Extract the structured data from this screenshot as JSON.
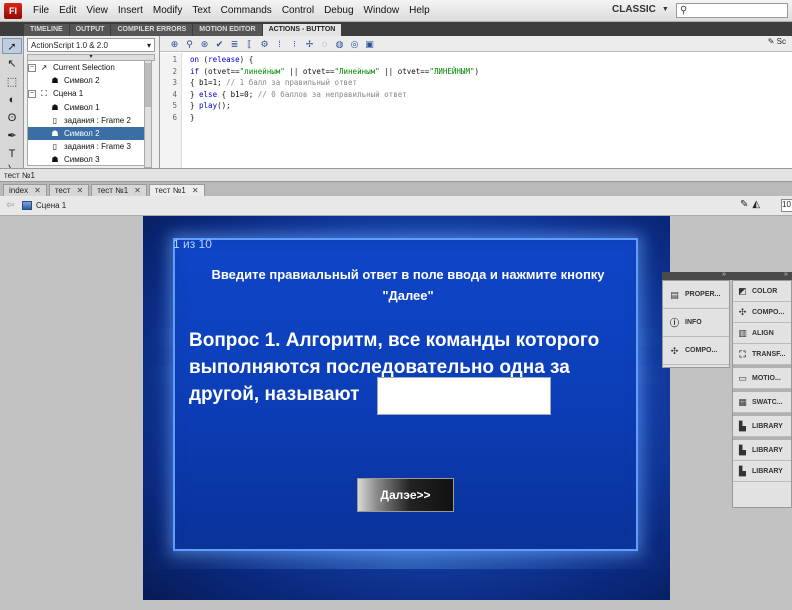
{
  "menubar": {
    "logo": "Fl",
    "items": [
      "File",
      "Edit",
      "View",
      "Insert",
      "Modify",
      "Text",
      "Commands",
      "Control",
      "Debug",
      "Window",
      "Help"
    ],
    "workspace": "CLASSIC",
    "search_icon": "search-icon"
  },
  "panel_tabs": [
    "TIMELINE",
    "OUTPUT",
    "COMPILER ERRORS",
    "MOTION EDITOR",
    "ACTIONS - BUTTON"
  ],
  "actions": {
    "version": "ActionScript 1.0 & 2.0",
    "tree": [
      {
        "label": "Current Selection",
        "expander": "−",
        "icon": "selection-icon"
      },
      {
        "label": "Символ 2",
        "icon": "button-symbol-icon"
      },
      {
        "label": "Сцена 1",
        "expander": "−",
        "icon": "scene-icon"
      },
      {
        "label": "Символ 1",
        "icon": "button-symbol-icon"
      },
      {
        "label": "задания : Frame 2",
        "icon": "frame-icon"
      },
      {
        "label": "Символ 2",
        "icon": "button-symbol-icon",
        "selected": true
      },
      {
        "label": "задания : Frame 3",
        "icon": "frame-icon"
      },
      {
        "label": "Символ 3",
        "icon": "button-symbol-icon"
      }
    ],
    "script_assist": "Sc",
    "code_lines": [
      [
        {
          "t": "kw",
          "v": "on"
        },
        {
          "t": "txt",
          "v": " ("
        },
        {
          "t": "kw",
          "v": "release"
        },
        {
          "t": "txt",
          "v": ") {"
        }
      ],
      [
        {
          "t": "kw",
          "v": "if"
        },
        {
          "t": "txt",
          "v": " (otvet=="
        },
        {
          "t": "str",
          "v": "\"линейным\""
        },
        {
          "t": "txt",
          "v": " || otvet=="
        },
        {
          "t": "str",
          "v": "\"Линейным\""
        },
        {
          "t": "txt",
          "v": " || otvet=="
        },
        {
          "t": "str",
          "v": "\"ЛИНЕЙНЫМ\""
        },
        {
          "t": "txt",
          "v": ")"
        }
      ],
      [
        {
          "t": "txt",
          "v": "{ b1=1; "
        },
        {
          "t": "cmt",
          "v": "// 1 балл за правильный ответ"
        }
      ],
      [
        {
          "t": "txt",
          "v": "} "
        },
        {
          "t": "kw",
          "v": "else"
        },
        {
          "t": "txt",
          "v": " { b1=0; "
        },
        {
          "t": "cmt",
          "v": "// 0 баллов за неправильный ответ"
        }
      ],
      [
        {
          "t": "txt",
          "v": "} "
        },
        {
          "t": "kw",
          "v": "play"
        },
        {
          "t": "txt",
          "v": "();"
        }
      ],
      [
        {
          "t": "txt",
          "v": "}"
        }
      ]
    ],
    "line_numbers": [
      "1",
      "2",
      "3",
      "4",
      "5",
      "6"
    ],
    "status": "тест №1"
  },
  "doc_tabs": [
    {
      "label": "index"
    },
    {
      "label": "тест"
    },
    {
      "label": "тест №1"
    },
    {
      "label": "тест №1",
      "active": true
    }
  ],
  "edit_bar": {
    "scene": "Сцена 1",
    "zoom": "10"
  },
  "stage": {
    "counter": "1 из 10",
    "instruction": "Введите правиальный ответ в поле ввода и нажмите кнопку \"Далее\"",
    "question": "Вопрос 1. Алгоритм, все команды которого выполняются последовательно одна за другой, называют",
    "answer_value": "",
    "next_label": "Далэе>>"
  },
  "floating_panels": {
    "left": [
      {
        "label": "PROPER...",
        "icon": "properties-icon"
      },
      {
        "label": "INFO",
        "icon": "info-icon"
      },
      {
        "label": "COMPO...",
        "icon": "components-icon"
      }
    ],
    "right": [
      {
        "label": "COLOR",
        "icon": "color-icon"
      },
      {
        "label": "COMPO...",
        "icon": "components-icon"
      },
      {
        "label": "ALIGN",
        "icon": "align-icon"
      },
      {
        "label": "TRANSF...",
        "icon": "transform-icon"
      },
      {
        "label": "MOTIO...",
        "icon": "motion-presets-icon"
      },
      {
        "label": "SWATC...",
        "icon": "swatches-icon"
      },
      {
        "label": "LIBRARY",
        "icon": "library-icon"
      },
      {
        "label": "LIBRARY",
        "icon": "library-icon"
      },
      {
        "label": "LIBRARY",
        "icon": "library-icon"
      }
    ]
  }
}
